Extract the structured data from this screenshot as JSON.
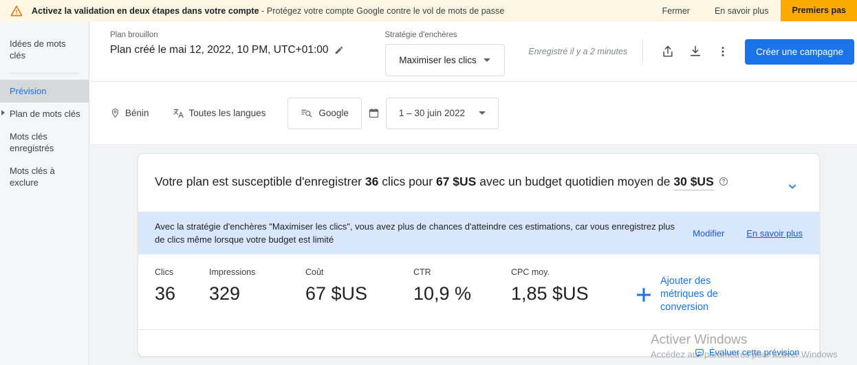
{
  "banner": {
    "warning_icon": "warning-triangle-icon",
    "text_bold": "Activez la validation en deux étapes dans votre compte",
    "text_rest": " - Protégez votre compte Google contre le vol de mots de passe",
    "close_label": "Fermer",
    "learn_more_label": "En savoir plus",
    "cta_label": "Premiers pas",
    "cta_color": "#f9ab00",
    "background": "#fdf6e3"
  },
  "sidebar": {
    "items": [
      {
        "label": "Idées de mots clés",
        "active": false,
        "caret": false
      },
      {
        "label": "Prévision",
        "active": true,
        "caret": false
      },
      {
        "label": "Plan de mots clés",
        "active": false,
        "caret": true
      },
      {
        "label": "Mots clés enregistrés",
        "active": false,
        "caret": false
      },
      {
        "label": "Mots clés à exclure",
        "active": false,
        "caret": false
      }
    ]
  },
  "toolbar": {
    "plan_label": "Plan brouillon",
    "plan_title": "Plan créé le mai 12, 2022, 10 PM, UTC+01:00",
    "edit_icon": "pencil-icon",
    "bid_label": "Stratégie d'enchères",
    "bid_value": "Maximiser les clics",
    "saved_text": "Enregistré il y a 2 minutes",
    "share_icon": "share-icon",
    "download_icon": "download-icon",
    "more_icon": "more-vert-icon",
    "create_campaign_label": "Créer une campagne",
    "primary_color": "#1a73e8"
  },
  "filters": {
    "location_icon": "location-pin-icon",
    "location": "Bénin",
    "language_icon": "translate-icon",
    "language": "Toutes les langues",
    "network_icon": "network-search-icon",
    "network": "Google",
    "calendar_icon": "calendar-icon",
    "date_range": "1 – 30 juin 2022"
  },
  "forecast_card": {
    "headline_p1": "Votre plan est susceptible d'enregistrer ",
    "headline_clicks": "36",
    "headline_p2": " clics pour ",
    "headline_cost": "67 $US",
    "headline_p3": " avec un budget quotidien moyen de ",
    "headline_budget": "30 $US",
    "help_icon": "help-circle-icon",
    "collapse_icon": "chevron-down-icon",
    "info_message": "Avec la stratégie d'enchères \"Maximiser les clics\", vous avez plus de chances d'atteindre ces estimations, car vous enregistrez plus de clics même lorsque votre budget est limité",
    "info_modify_label": "Modifier",
    "info_learn_label": "En savoir plus",
    "info_background": "#d9e7fd",
    "metrics": [
      {
        "label": "Clics",
        "value": "36"
      },
      {
        "label": "Impressions",
        "value": "329"
      },
      {
        "label": "Coût",
        "value": "67 $US"
      },
      {
        "label": "CTR",
        "value": "10,9 %"
      },
      {
        "label": "CPC moy.",
        "value": "1,85 $US"
      }
    ],
    "add_conversion_icon": "plus-icon",
    "add_conversion_label": "Ajouter des métriques de conversion"
  },
  "footer": {
    "rate_icon": "feedback-icon",
    "rate_label": "Évaluer cette prévision"
  },
  "watermark": {
    "title": "Activer Windows",
    "subtitle": "Accédez aux paramètres pour activer Windows"
  }
}
